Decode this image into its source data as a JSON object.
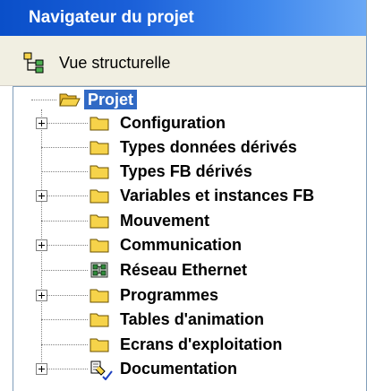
{
  "window": {
    "title": "Navigateur du projet"
  },
  "toolbar": {
    "view_label": "Vue structurelle",
    "view_icon": "structure-tree-icon"
  },
  "tree": {
    "root": {
      "label": "Projet",
      "icon": "open-folder-icon",
      "selected": true
    },
    "items": [
      {
        "label": "Configuration",
        "icon": "folder-icon",
        "expandable": true
      },
      {
        "label": "Types données dérivés",
        "icon": "folder-icon",
        "expandable": false
      },
      {
        "label": "Types FB dérivés",
        "icon": "folder-icon",
        "expandable": false
      },
      {
        "label": "Variables et instances FB",
        "icon": "folder-icon",
        "expandable": true
      },
      {
        "label": "Mouvement",
        "icon": "folder-icon",
        "expandable": false
      },
      {
        "label": "Communication",
        "icon": "folder-icon",
        "expandable": true
      },
      {
        "label": "Réseau Ethernet",
        "icon": "ethernet-network-icon",
        "expandable": false
      },
      {
        "label": "Programmes",
        "icon": "folder-icon",
        "expandable": true
      },
      {
        "label": "Tables d'animation",
        "icon": "folder-icon",
        "expandable": false
      },
      {
        "label": "Ecrans d'exploitation",
        "icon": "folder-icon",
        "expandable": false
      },
      {
        "label": "Documentation",
        "icon": "documentation-icon",
        "expandable": true
      }
    ]
  },
  "colors": {
    "title_bar": "#1a5fd8",
    "selection": "#316ac5",
    "folder": "#f6d34a",
    "toolbar_bg": "#f1efe2"
  }
}
